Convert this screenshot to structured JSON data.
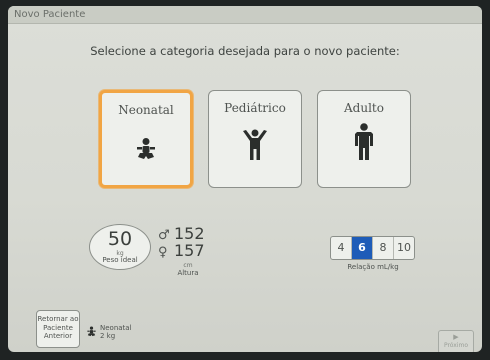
{
  "window": {
    "title": "Novo Paciente"
  },
  "prompt": "Selecione a categoria desejada para o novo paciente:",
  "categories": [
    {
      "label": "Neonatal",
      "icon": "neonatal-icon",
      "selected": true
    },
    {
      "label": "Pediátrico",
      "icon": "child-icon",
      "selected": false
    },
    {
      "label": "Adulto",
      "icon": "adult-icon",
      "selected": false
    }
  ],
  "weight": {
    "value": "50",
    "unit": "kg",
    "label": "Peso ideal"
  },
  "height": {
    "male_value": "152",
    "female_value": "157",
    "unit": "cm",
    "label": "Altura"
  },
  "ratio": {
    "options": [
      "4",
      "6",
      "8",
      "10"
    ],
    "selected": "6",
    "label": "Relação mL/kg"
  },
  "previous_patient": {
    "button_line1": "Retornar ao",
    "button_line2": "Paciente",
    "button_line3": "Anterior",
    "category": "Neonatal",
    "weight": "2 kg"
  },
  "next_button": {
    "label": "Próximo"
  },
  "colors": {
    "selected_border": "#f1a544",
    "active_ratio": "#1e5cb8",
    "background": "#d8dad3"
  }
}
